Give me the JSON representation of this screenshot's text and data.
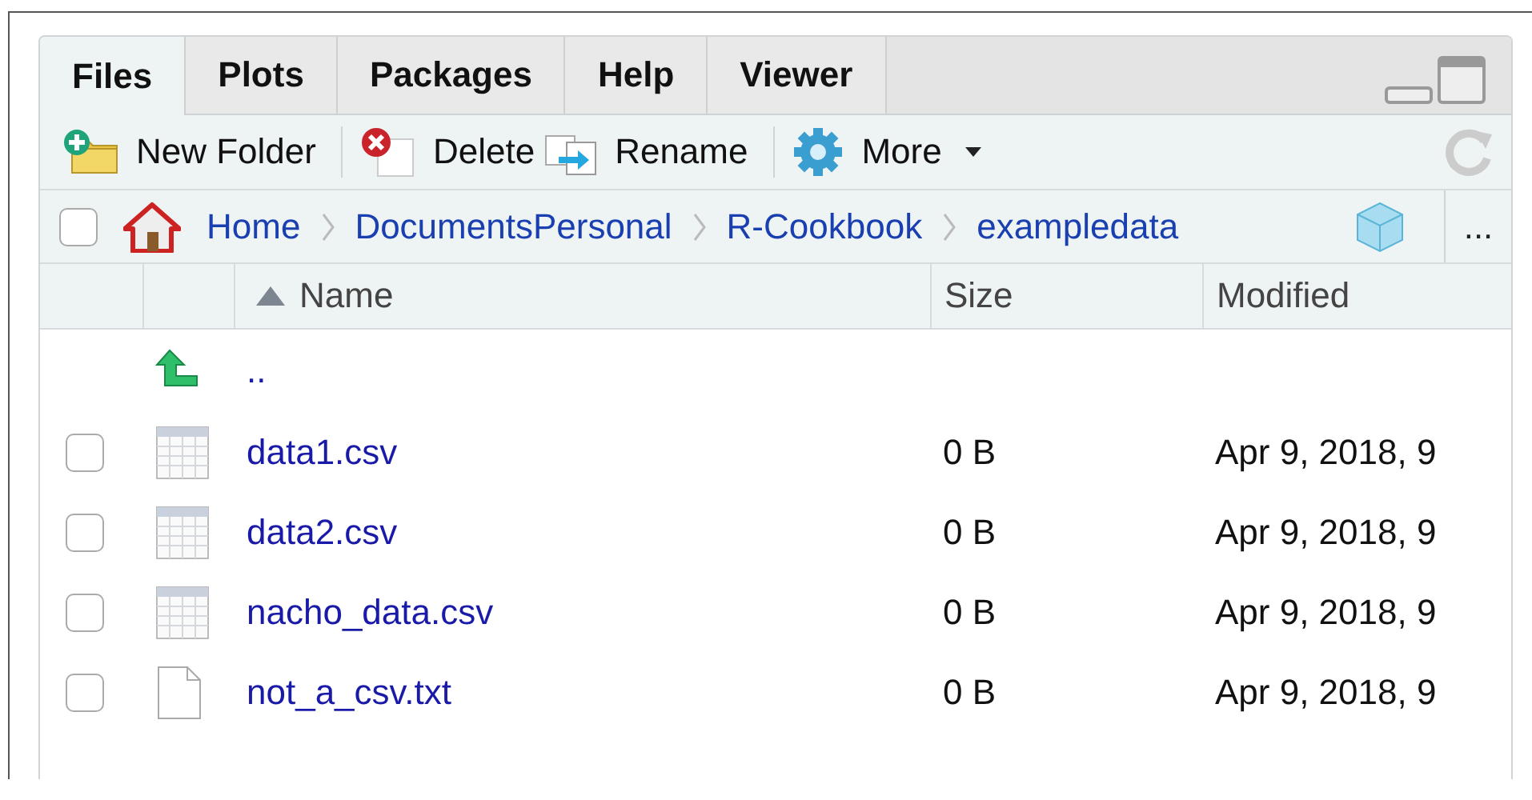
{
  "tabs": [
    {
      "label": "Files",
      "selected": true
    },
    {
      "label": "Plots",
      "selected": false
    },
    {
      "label": "Packages",
      "selected": false
    },
    {
      "label": "Help",
      "selected": false
    },
    {
      "label": "Viewer",
      "selected": false
    }
  ],
  "toolbar": [
    {
      "kind": "new-folder",
      "label": "New Folder"
    },
    {
      "kind": "separator"
    },
    {
      "kind": "delete",
      "label": "Delete"
    },
    {
      "kind": "rename",
      "label": "Rename"
    },
    {
      "kind": "separator"
    },
    {
      "kind": "more",
      "label": "More"
    }
  ],
  "breadcrumb": {
    "checked": false,
    "path": [
      "Home",
      "DocumentsPersonal",
      "R-Cookbook",
      "exampledata"
    ],
    "more": "..."
  },
  "table": {
    "columns": [
      {
        "label": "Name",
        "sorted": true
      },
      {
        "label": "Size",
        "sorted": false
      },
      {
        "label": "Modified",
        "sorted": false
      }
    ],
    "rows": [
      {
        "kind": "parent",
        "name": ".."
      },
      {
        "kind": "csv",
        "name": "data1.csv",
        "size": "0 B",
        "modified": "Apr 9, 2018, 9",
        "checked": false
      },
      {
        "kind": "csv",
        "name": "data2.csv",
        "size": "0 B",
        "modified": "Apr 9, 2018, 9",
        "checked": false
      },
      {
        "kind": "csv",
        "name": "nacho_data.csv",
        "size": "0 B",
        "modified": "Apr 9, 2018, 9",
        "checked": false
      },
      {
        "kind": "text",
        "name": "not_a_csv.txt",
        "size": "0 B",
        "modified": "Apr 9, 2018, 9",
        "checked": false
      }
    ]
  }
}
